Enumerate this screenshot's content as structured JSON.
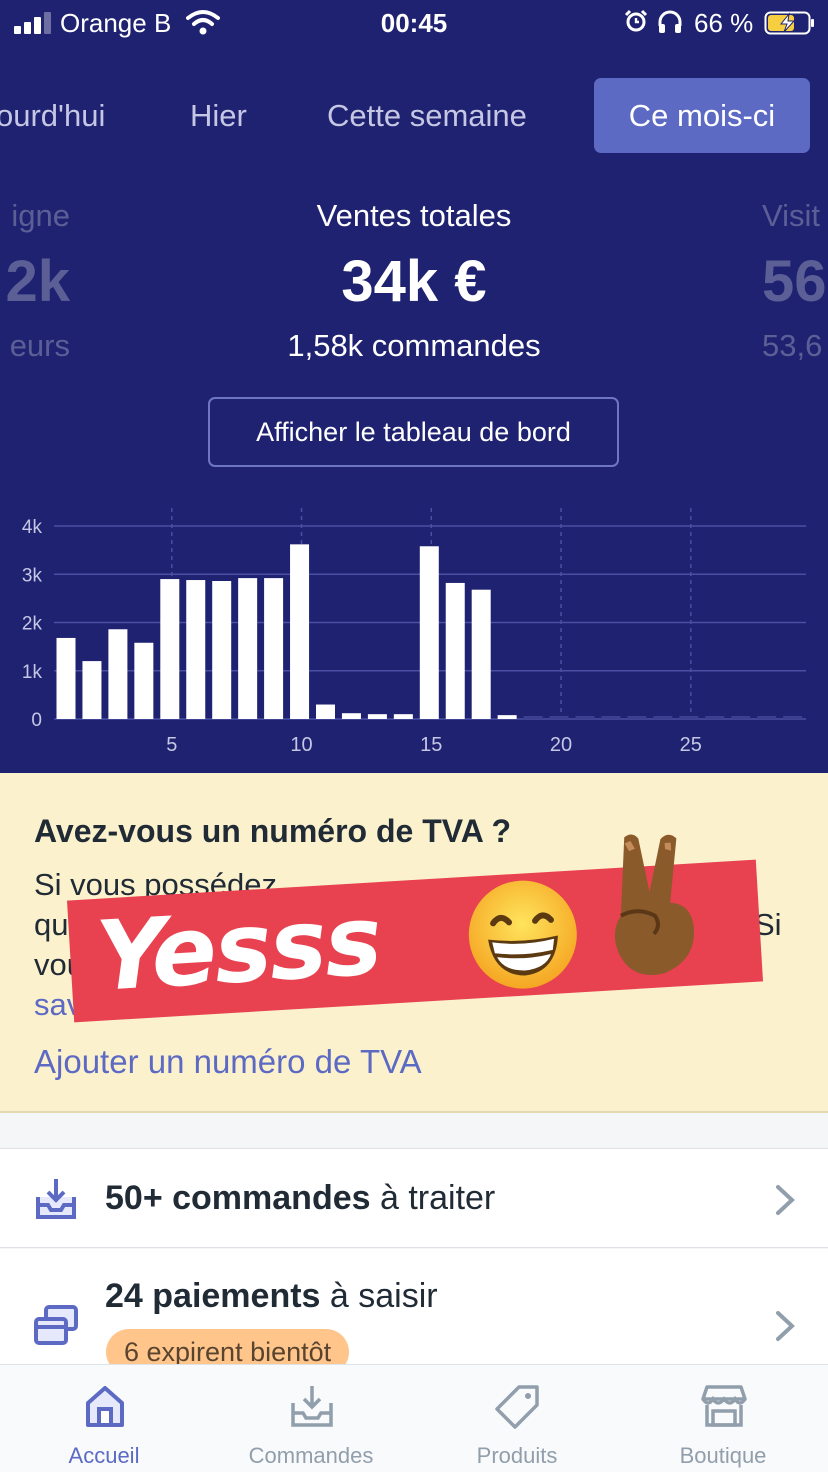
{
  "status_bar": {
    "carrier": "Orange B",
    "time": "00:45",
    "battery_percent": "66 %",
    "signal_bars": 3,
    "battery_level": 0.66,
    "battery_charging": true
  },
  "period_tabs": [
    {
      "label": "ourd'hui",
      "active": false
    },
    {
      "label": "Hier",
      "active": false
    },
    {
      "label": "Cette semaine",
      "active": false
    },
    {
      "label": "Ce mois-ci",
      "active": true
    }
  ],
  "stats": {
    "left": {
      "label": "igne",
      "value": "2k",
      "sub": "eurs"
    },
    "center": {
      "label": "Ventes totales",
      "value": "34k €",
      "sub": "1,58k commandes"
    },
    "right": {
      "label": "Visit",
      "value": "56",
      "sub": "53,6"
    }
  },
  "dashboard_button": "Afficher le tableau de bord",
  "chart_data": {
    "type": "bar",
    "y_tick_labels": [
      "0",
      "1k",
      "2k",
      "3k",
      "4k"
    ],
    "ylim": [
      0,
      4000
    ],
    "x_tick_labels": [
      "5",
      "10",
      "15",
      "20",
      "25"
    ],
    "x": [
      1,
      2,
      3,
      4,
      5,
      6,
      7,
      8,
      9,
      10,
      11,
      12,
      13,
      14,
      15,
      16,
      17,
      18,
      19,
      20,
      21,
      22,
      23,
      24,
      25,
      26,
      27,
      28,
      29
    ],
    "values": [
      1680,
      1200,
      1860,
      1580,
      2900,
      2880,
      2860,
      2920,
      2920,
      3620,
      300,
      120,
      100,
      100,
      3580,
      2820,
      2680,
      80,
      0,
      0,
      0,
      0,
      0,
      0,
      0,
      0,
      0,
      0,
      0
    ],
    "grid": true,
    "bar_color": "#ffffff",
    "background": "#1f2270"
  },
  "banner": {
    "title": "Avez-vous un numéro de TVA ?",
    "text_lines": [
      "Si vous possédez",
      "qu",
      "vou",
      "sav"
    ],
    "text_line_right": "Si",
    "link": "Ajouter un numéro de TVA"
  },
  "sticker": {
    "text": "Yesss",
    "emojis": [
      "grinning-face",
      "victory-hand"
    ]
  },
  "tasks": [
    {
      "bold": "50+ commandes",
      "rest": " à traiter",
      "icon": "inbox-download-icon"
    },
    {
      "bold": "24 paiements",
      "rest": " à saisir",
      "icon": "payment-cards-icon",
      "badge": "6 expirent bientôt"
    }
  ],
  "tab_bar": [
    {
      "label": "Accueil",
      "icon": "home-icon",
      "active": true
    },
    {
      "label": "Commandes",
      "icon": "orders-icon",
      "active": false
    },
    {
      "label": "Produits",
      "icon": "tag-icon",
      "active": false
    },
    {
      "label": "Boutique",
      "icon": "store-icon",
      "active": false
    }
  ],
  "colors": {
    "navy": "#1f2270",
    "indigo": "#5c6ac4",
    "banner": "#fcf1cd",
    "sticker_red": "#e8414f",
    "badge_orange": "#ffc58b"
  }
}
